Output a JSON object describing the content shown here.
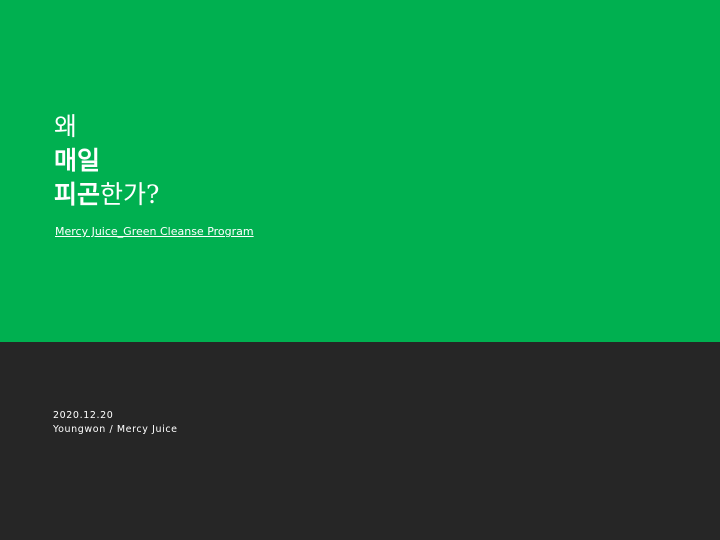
{
  "title": {
    "line1": "왜",
    "line2": "매일",
    "line3_bold": "피곤",
    "line3_rest": "한가?"
  },
  "subtitle": "Mercy Juice_Green Cleanse Program",
  "meta": {
    "date": "2020.12.20",
    "author": "Youngwon / Mercy Juice"
  },
  "colors": {
    "top_background": "#00b050",
    "bottom_background": "#262626",
    "text": "#ffffff"
  }
}
